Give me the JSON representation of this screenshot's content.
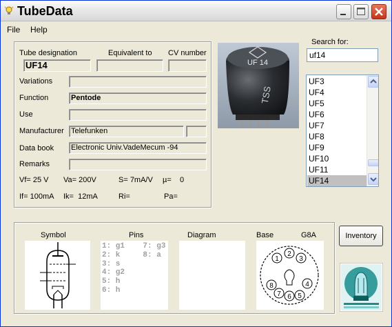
{
  "window": {
    "title": "TubeData",
    "icon": "lightbulb-icon"
  },
  "menu": {
    "file": "File",
    "help": "Help"
  },
  "details": {
    "tube_designation_label": "Tube designation",
    "equivalent_label": "Equivalent to",
    "cv_label": "CV number",
    "tube_designation": "UF14",
    "equivalent": "",
    "cv_number": "",
    "variations_label": "Variations",
    "variations": "",
    "function_label": "Function",
    "function": "Pentode",
    "use_label": "Use",
    "use": "",
    "manufacturer_label": "Manufacturer",
    "manufacturer": "Telefunken",
    "manufacturer_extra": "",
    "databook_label": "Data book",
    "databook": "Electronic Univ.VadeMecum -94",
    "remarks_label": "Remarks",
    "remarks": ""
  },
  "specs": {
    "vf": "Vf= 25 V",
    "va": "Va=  200V",
    "s": "S= 7mA/V",
    "mu": "µ=    0",
    "if": "If= 100mA",
    "ik": "Ik=  12mA",
    "ri": "Ri=",
    "pa": "Pa="
  },
  "photo": {
    "tube_text": "UF 14",
    "brand": "Telefunken logo",
    "bottom_text": "TSS"
  },
  "search": {
    "label": "Search for:",
    "value": "uf14"
  },
  "tube_list": [
    "UF3",
    "UF4",
    "UF5",
    "UF6",
    "UF7",
    "UF8",
    "UF9",
    "UF10",
    "UF11",
    "UF14"
  ],
  "tube_list_selected": "UF14",
  "bottom": {
    "symbol_label": "Symbol",
    "pins_label": "Pins",
    "diagram_label": "Diagram",
    "base_label": "Base",
    "base_type": "G8A",
    "pins_text": "1: g1    7: g3\n2: k     8: a\n3: s\n4: g2\n5: h\n6: h",
    "base_pins": [
      "1",
      "2",
      "3",
      "4",
      "5",
      "6",
      "7",
      "8"
    ]
  },
  "inventory_button": "Inventory",
  "colors": {
    "title_close": "#c6341a",
    "list_selected": "#c0c0c0",
    "logo_teal": "#1a8c8c"
  }
}
